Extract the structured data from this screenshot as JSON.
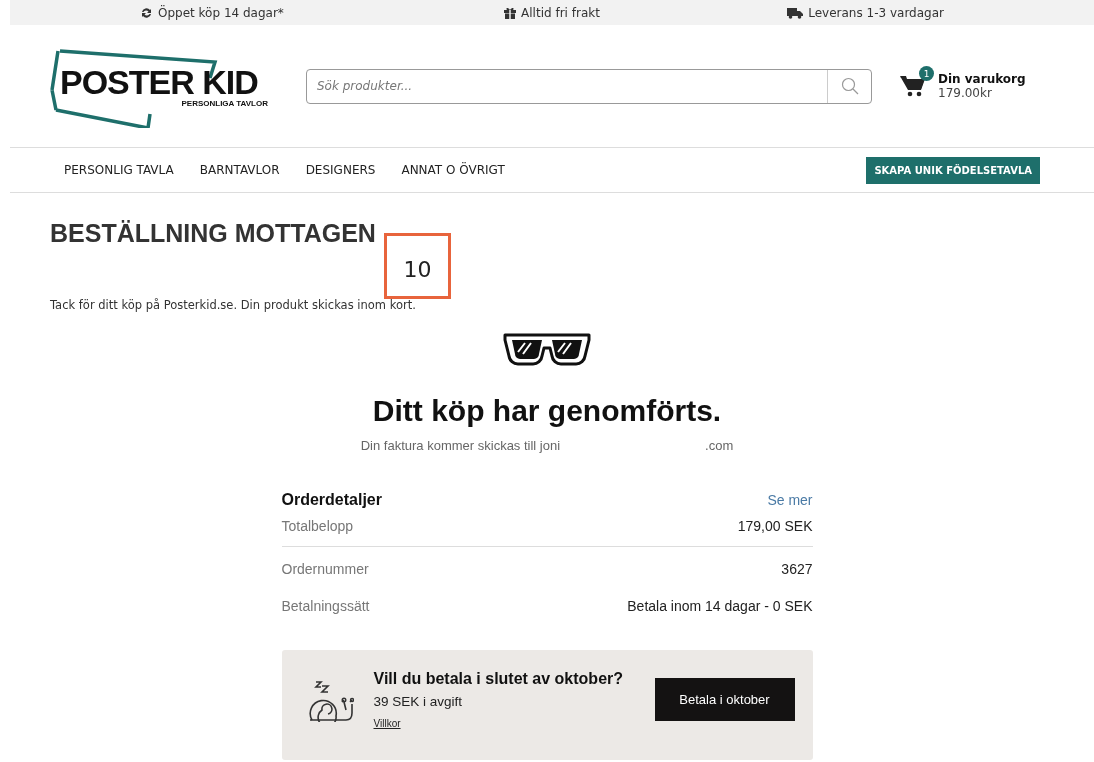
{
  "topbar": [
    {
      "kind": "return",
      "text": "Öppet köp 14 dagar*"
    },
    {
      "kind": "gift",
      "text": "Alltid fri frakt"
    },
    {
      "kind": "truck",
      "text": "Leverans 1-3 vardagar"
    }
  ],
  "logo": {
    "title": "POSTER KID",
    "subtitle": "PERSONLIGA TAVLOR"
  },
  "search": {
    "placeholder": "Sök produkter..."
  },
  "cart": {
    "count": "1",
    "label": "Din varukorg",
    "total": "179.00kr"
  },
  "nav": {
    "items": [
      "PERSONLIG TAVLA",
      "BARNTAVLOR",
      "DESIGNERS",
      "ANNAT O ÖVRIGT"
    ],
    "cta": "SKAPA UNIK FÖDELSETAVLA"
  },
  "page": {
    "heading": "BESTÄLLNING MOTTAGEN",
    "thanks": "Tack för ditt köp på Posterkid.se. Din produkt skickas inom kort."
  },
  "annotation": {
    "label": "10"
  },
  "confirmation": {
    "title": "Ditt köp har genomförts.",
    "invoice_prefix": "Din faktura kommer skickas till joni",
    "invoice_suffix": ".com"
  },
  "order": {
    "title": "Orderdetaljer",
    "link": "Se mer",
    "rows": [
      {
        "label": "Totalbelopp",
        "value": "179,00 SEK",
        "divider": true
      },
      {
        "label": "Ordernummer",
        "value": "3627",
        "divider": false
      },
      {
        "label": "Betalningssätt",
        "value": "Betala inom 14 dagar - 0 SEK",
        "divider": false
      }
    ]
  },
  "promo": {
    "title": "Vill du betala i slutet av oktober?",
    "fee": "39 SEK i avgift",
    "terms": "Villkor",
    "button": "Betala i oktober"
  }
}
